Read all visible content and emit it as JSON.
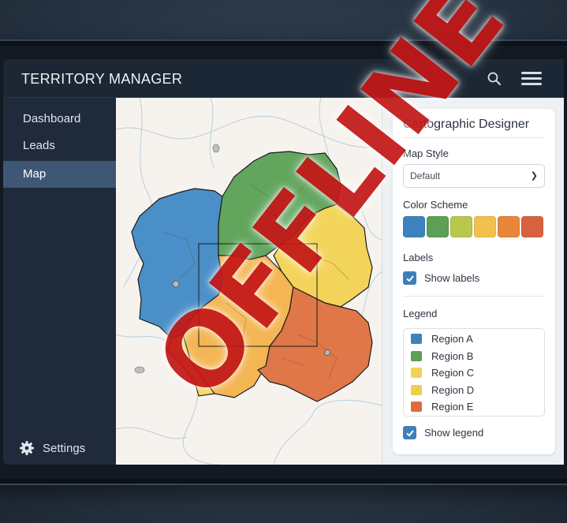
{
  "app": {
    "title": "TERRITORY MANAGER"
  },
  "header": {
    "icons": [
      "search-icon",
      "menu-icon"
    ]
  },
  "sidebar": {
    "items": [
      {
        "label": "Dashboard"
      },
      {
        "label": "Leads"
      },
      {
        "label": "Map",
        "active": true
      }
    ],
    "settings_label": "Settings",
    "settings_icon": "gear-icon"
  },
  "panel": {
    "title": "Cartographic Designer",
    "map_style": {
      "label": "Map Style",
      "value": "Default"
    },
    "color_scheme": {
      "label": "Color Scheme",
      "colors": [
        "#3d82bd",
        "#5c9f55",
        "#b6c84e",
        "#f2c04d",
        "#e9863c",
        "#d8613e"
      ]
    },
    "labels": {
      "label": "Labels",
      "checkbox_label": "Show labels",
      "checked": true
    },
    "legend": {
      "label": "Legend",
      "items": [
        {
          "label": "Region A",
          "color": "#3d82bd"
        },
        {
          "label": "Region B",
          "color": "#5c9f55"
        },
        {
          "label": "Region C",
          "color": "#f0d257"
        },
        {
          "label": "Region D",
          "color": "#edcf4d"
        },
        {
          "label": "Region E",
          "color": "#de6c3d"
        }
      ],
      "checkbox_label": "Show legend",
      "checked": true
    }
  },
  "map": {
    "regions": [
      {
        "name": "Region A",
        "color": "#4a8fc8"
      },
      {
        "name": "Region B",
        "color": "#62a55d"
      },
      {
        "name": "Region C",
        "color": "#f3d45a"
      },
      {
        "name": "Region D",
        "color": "#f4b552"
      },
      {
        "name": "Region E",
        "color": "#e07748"
      }
    ]
  },
  "overlay": {
    "text": "OFFLINE",
    "color": "#c31818"
  }
}
